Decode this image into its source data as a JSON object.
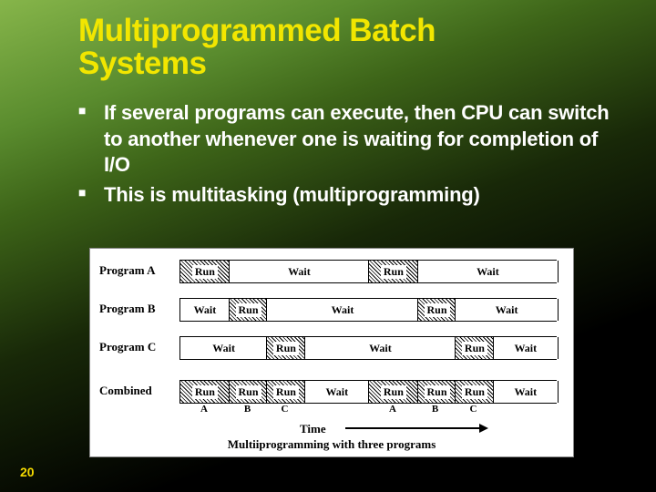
{
  "title_line1": "Multiprogrammed Batch",
  "title_line2": "Systems",
  "bullets": {
    "b1": "If several programs can execute, then CPU can switch to another whenever one is waiting for completion of I/O",
    "b2": "This is multitasking (multiprogramming)"
  },
  "diagram": {
    "rows": {
      "a": "Program A",
      "b": "Program B",
      "c": "Program C",
      "d": "Combined"
    },
    "labels": {
      "run": "Run",
      "wait": "Wait",
      "runA": "Run",
      "runB": "Run",
      "runC": "Run",
      "A": "A",
      "B": "B",
      "C": "C"
    },
    "time": "Time",
    "caption": "Multiiprogramming with three programs"
  },
  "page": "20"
}
